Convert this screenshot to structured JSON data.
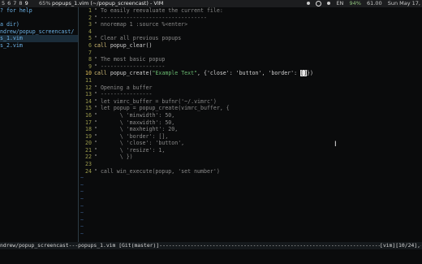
{
  "topbar": {
    "workspaces": [
      "5",
      "6",
      "7",
      "8",
      "9"
    ],
    "current_workspace": "9",
    "cpu": "65%",
    "window_title": "popups_1.vim (~/popup_screencast) - VIM",
    "lang": "EN",
    "battery": "94%",
    "temp": "61.00",
    "clock": "Sun May 17,"
  },
  "left_pane": {
    "lines": [
      "? for help",
      "",
      "a dir)",
      "ndrew/popup_screencast/",
      "s_1.vim",
      "s_2.vim"
    ],
    "selected_index": 4
  },
  "editor": {
    "cursor_line": 10,
    "lines": [
      {
        "n": "1",
        "parts": [
          {
            "cls": "c",
            "text": "\" To easily reevaluate the current file:"
          }
        ]
      },
      {
        "n": "2",
        "parts": [
          {
            "cls": "c",
            "text": "\" ---------------------------------"
          }
        ]
      },
      {
        "n": "3",
        "parts": [
          {
            "cls": "c",
            "text": "\" nnoremap 1 :source %<enter>"
          }
        ]
      },
      {
        "n": "4",
        "parts": []
      },
      {
        "n": "5",
        "parts": [
          {
            "cls": "c",
            "text": "\" Clear all previous popups"
          }
        ]
      },
      {
        "n": "6",
        "parts": [
          {
            "cls": "k",
            "text": "call"
          },
          {
            "cls": "t",
            "text": " popup_clear()"
          }
        ]
      },
      {
        "n": "7",
        "parts": []
      },
      {
        "n": "8",
        "parts": [
          {
            "cls": "c",
            "text": "\" The most basic popup"
          }
        ]
      },
      {
        "n": "9",
        "parts": [
          {
            "cls": "c",
            "text": "\" --------------------"
          }
        ]
      },
      {
        "n": "10",
        "parts": [
          {
            "cls": "k",
            "text": "call"
          },
          {
            "cls": "t",
            "text": " popup_create("
          },
          {
            "cls": "s",
            "text": "\"Example Text\""
          },
          {
            "cls": "t",
            "text": ", {'close': 'button', 'border': "
          },
          {
            "cls": "cursor",
            "text": "[]"
          },
          {
            "cls": "t",
            "text": "})"
          }
        ]
      },
      {
        "n": "11",
        "parts": []
      },
      {
        "n": "12",
        "parts": [
          {
            "cls": "c",
            "text": "\" Opening a buffer"
          }
        ]
      },
      {
        "n": "13",
        "parts": [
          {
            "cls": "c",
            "text": "\" ----------------"
          }
        ]
      },
      {
        "n": "14",
        "parts": [
          {
            "cls": "c",
            "text": "\" let vimrc_buffer = bufnr('~/.vimrc')"
          }
        ]
      },
      {
        "n": "15",
        "parts": [
          {
            "cls": "c",
            "text": "\" let popup = popup_create(vimrc_buffer, {"
          }
        ]
      },
      {
        "n": "16",
        "parts": [
          {
            "cls": "c",
            "text": "\"       \\ 'minwidth': 50,"
          }
        ]
      },
      {
        "n": "17",
        "parts": [
          {
            "cls": "c",
            "text": "\"       \\ 'maxwidth': 50,"
          }
        ]
      },
      {
        "n": "18",
        "parts": [
          {
            "cls": "c",
            "text": "\"       \\ 'maxheight': 20,"
          }
        ]
      },
      {
        "n": "19",
        "parts": [
          {
            "cls": "c",
            "text": "\"       \\ 'border': [],"
          }
        ]
      },
      {
        "n": "20",
        "parts": [
          {
            "cls": "c",
            "text": "\"       \\ 'close': 'button',"
          }
        ]
      },
      {
        "n": "21",
        "parts": [
          {
            "cls": "c",
            "text": "\"       \\ 'resize': 1,"
          }
        ]
      },
      {
        "n": "22",
        "parts": [
          {
            "cls": "c",
            "text": "\"       \\ })"
          }
        ]
      },
      {
        "n": "23",
        "parts": []
      },
      {
        "n": "24",
        "parts": [
          {
            "cls": "c",
            "text": "\" call win_execute(popup, 'set number')"
          }
        ]
      }
    ],
    "tilde_count": 9,
    "tilde_char": "~"
  },
  "statusline": {
    "left": "ndrew/popup_screencast---popups_1.vim [Git(master)]------------------------------------------------------------------------------------------------",
    "right": "[vim][10/24],"
  }
}
